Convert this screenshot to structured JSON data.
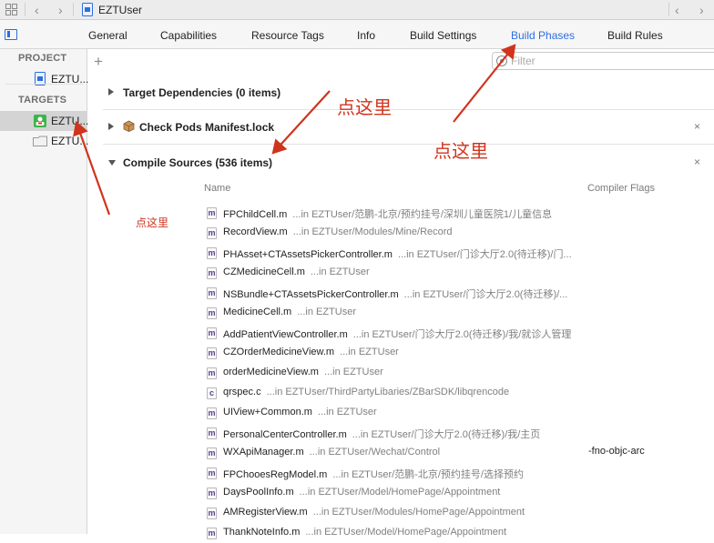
{
  "window": {
    "doc_title": "EZTUser"
  },
  "tabs": [
    {
      "label": "General",
      "active": false
    },
    {
      "label": "Capabilities",
      "active": false
    },
    {
      "label": "Resource Tags",
      "active": false
    },
    {
      "label": "Info",
      "active": false
    },
    {
      "label": "Build Settings",
      "active": false
    },
    {
      "label": "Build Phases",
      "active": true
    },
    {
      "label": "Build Rules",
      "active": false
    }
  ],
  "sidebar": {
    "project_header": "PROJECT",
    "project_item": "EZTU...",
    "targets_header": "TARGETS",
    "targets": [
      {
        "label": "EZTU...",
        "selected": true
      },
      {
        "label": "EZTU...",
        "selected": false
      }
    ]
  },
  "toolbar": {
    "filter_placeholder": "Filter"
  },
  "phases": [
    {
      "title": "Target Dependencies (0 items)",
      "expanded": false,
      "closable": false
    },
    {
      "title": "Check Pods Manifest.lock",
      "expanded": false,
      "closable": true
    },
    {
      "title": "Compile Sources (536 items)",
      "expanded": true,
      "closable": true
    }
  ],
  "close_glyph": "×",
  "compile_sources": {
    "columns": {
      "name": "Name",
      "flags": "Compiler Flags"
    },
    "files": [
      {
        "name": "FPChildCell.m",
        "path": "...in EZTUser/范鹏-北京/预约挂号/深圳儿童医院1/儿童信息",
        "flags": ""
      },
      {
        "name": "RecordView.m",
        "path": "...in EZTUser/Modules/Mine/Record",
        "flags": ""
      },
      {
        "name": "PHAsset+CTAssetsPickerController.m",
        "path": "...in EZTUser/门诊大厅2.0(待迁移)/门...",
        "flags": ""
      },
      {
        "name": "CZMedicineCell.m",
        "path": "...in EZTUser",
        "flags": ""
      },
      {
        "name": "NSBundle+CTAssetsPickerController.m",
        "path": "...in EZTUser/门诊大厅2.0(待迁移)/...",
        "flags": ""
      },
      {
        "name": "MedicineCell.m",
        "path": "...in EZTUser",
        "flags": ""
      },
      {
        "name": "AddPatientViewController.m",
        "path": "...in EZTUser/门诊大厅2.0(待迁移)/我/就诊人管理",
        "flags": ""
      },
      {
        "name": "CZOrderMedicineView.m",
        "path": "...in EZTUser",
        "flags": ""
      },
      {
        "name": "orderMedicineView.m",
        "path": "...in EZTUser",
        "flags": ""
      },
      {
        "name": "qrspec.c",
        "path": "...in EZTUser/ThirdPartyLibaries/ZBarSDK/libqrencode",
        "flags": ""
      },
      {
        "name": "UIView+Common.m",
        "path": "...in EZTUser",
        "flags": ""
      },
      {
        "name": "PersonalCenterController.m",
        "path": "...in EZTUser/门诊大厅2.0(待迁移)/我/主页",
        "flags": ""
      },
      {
        "name": "WXApiManager.m",
        "path": "...in EZTUser/Wechat/Control",
        "flags": "-fno-objc-arc"
      },
      {
        "name": "FPChooesRegModel.m",
        "path": "...in EZTUser/范鹏-北京/预约挂号/选择预约",
        "flags": ""
      },
      {
        "name": "DaysPoolInfo.m",
        "path": "...in EZTUser/Model/HomePage/Appointment",
        "flags": ""
      },
      {
        "name": "AMRegisterView.m",
        "path": "...in EZTUser/Modules/HomePage/Appointment",
        "flags": ""
      },
      {
        "name": "ThankNoteInfo.m",
        "path": "...in EZTUser/Model/HomePage/Appointment",
        "flags": ""
      }
    ]
  },
  "annotations": [
    {
      "text": "点这里"
    },
    {
      "text": "点这里"
    },
    {
      "text": "点这里"
    }
  ],
  "colors": {
    "accent": "#2d6ee0",
    "annotation_red": "#d0341c"
  }
}
